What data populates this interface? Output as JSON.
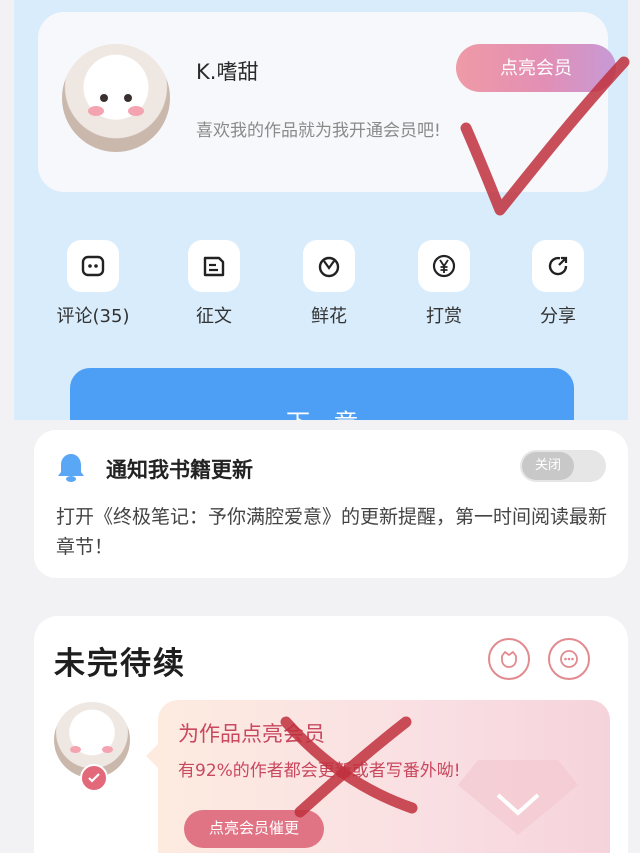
{
  "author": {
    "name": "K.嗜甜",
    "subtitle": "喜欢我的作品就为我开通会员吧!",
    "vip_button": "点亮会员"
  },
  "actions": [
    {
      "label": "评论(35)",
      "icon": "comment-icon"
    },
    {
      "label": "征文",
      "icon": "essay-icon"
    },
    {
      "label": "鲜花",
      "icon": "flower-icon"
    },
    {
      "label": "打赏",
      "icon": "yen-icon"
    },
    {
      "label": "分享",
      "icon": "share-icon"
    }
  ],
  "next_chapter_label": "下一章",
  "notify": {
    "title": "通知我书籍更新",
    "toggle_label": "关闭",
    "text": "打开《终极笔记：予你满腔爱意》的更新提醒，第一时间阅读最新章节！"
  },
  "story": {
    "title": "未完待续",
    "bubble_title": "为作品点亮会员",
    "bubble_sub": "有92%的作者都会更新或者写番外呦!",
    "bubble_button": "点亮会员催更"
  },
  "colors": {
    "accent_blue": "#4d9ff5",
    "panel_blue": "#d9ecfb",
    "pink": "#e07485",
    "annotation_red": "#c0303c"
  }
}
